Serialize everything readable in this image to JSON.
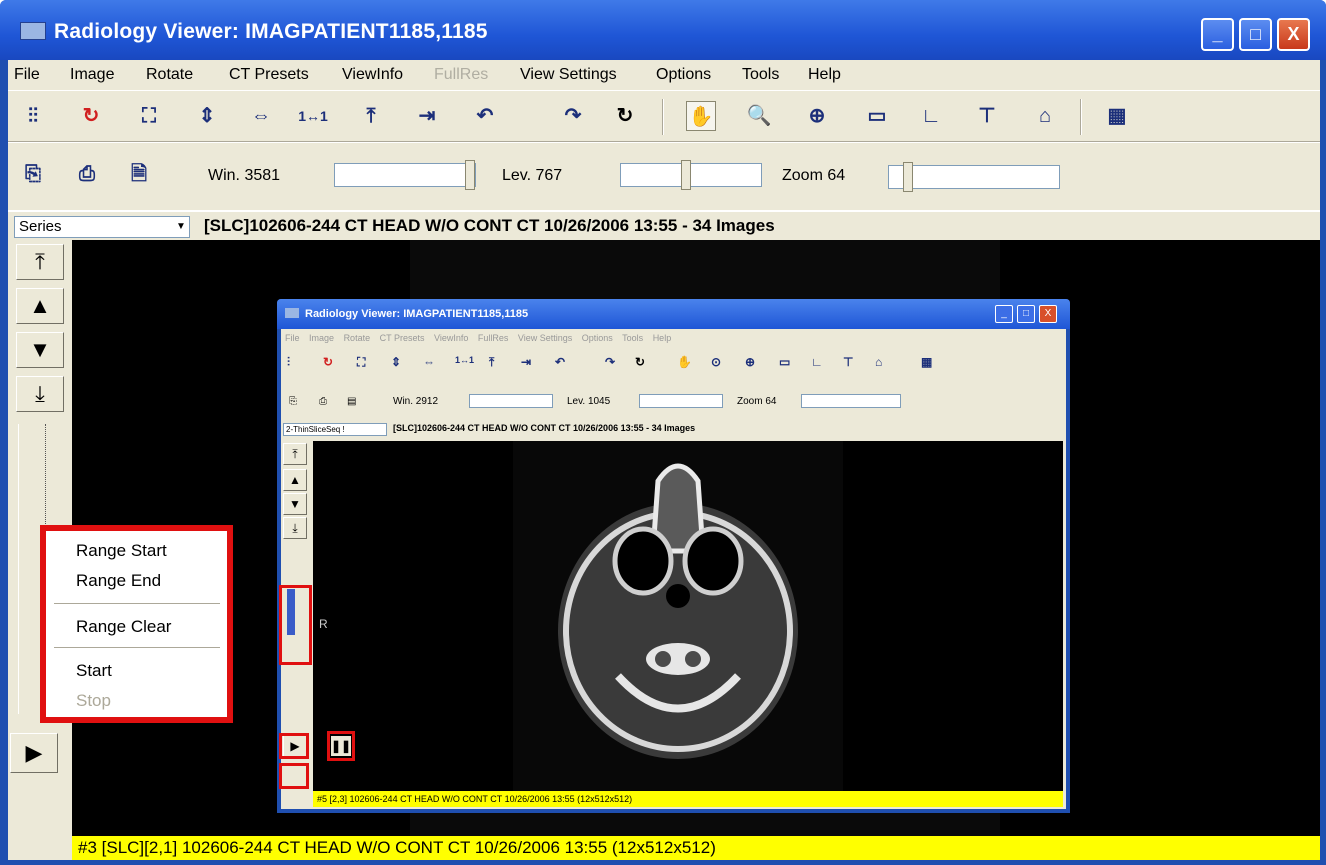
{
  "window": {
    "title": "Radiology Viewer: IMAGPATIENT1185,1185",
    "minimize": "_",
    "maximize": "□",
    "close": "X"
  },
  "menu": [
    "File",
    "Image",
    "Rotate",
    "CT Presets",
    "ViewInfo",
    "FullRes",
    "View Settings",
    "Options",
    "Tools",
    "Help"
  ],
  "menu_disabled": "FullRes",
  "toolbar": {
    "icons": [
      "stack-icon",
      "refresh-icon",
      "fit-icon",
      "flip-vertical-icon",
      "flip-horizontal-icon",
      "one-to-one-icon",
      "fit-height-icon",
      "fit-width-icon",
      "rotate-left-icon",
      "rotate-right-icon",
      "rotate-icon",
      "pan-hand-icon",
      "magnify-icon",
      "zoom-icon",
      "ruler-icon",
      "angle-icon",
      "measure-icon",
      "roi-icon",
      "grid-icon"
    ]
  },
  "toolbar2": {
    "win_label": "Win. 3581",
    "lev_label": "Lev. 767",
    "zoom_label": "Zoom  64"
  },
  "series": {
    "combo": "Series",
    "description": "[SLC]102606-244  CT HEAD W/O CONT CT 10/26/2006 13:55  - 34  Images"
  },
  "status": "#3 [SLC][2,1] 102606-244  CT HEAD W/O CONT CT 10/26/2006 13:55 (12x512x512)",
  "context_menu": {
    "items": [
      "Range Start",
      "Range End",
      "Range Clear",
      "Start",
      "Stop"
    ],
    "disabled": "Stop"
  },
  "inner": {
    "title": "Radiology Viewer: IMAGPATIENT1185,1185",
    "menu": [
      "File",
      "Image",
      "Rotate",
      "CT Presets",
      "ViewInfo",
      "FullRes",
      "View Settings",
      "Options",
      "Tools",
      "Help"
    ],
    "win_label": "Win. 2912",
    "lev_label": "Lev. 1045",
    "zoom_label": "Zoom  64",
    "series_combo": "2-ThinSliceSeq !",
    "series_description": "[SLC]102606-244  CT HEAD W/O CONT CT 10/26/2006 13:55  - 34  Images",
    "status": "#5 [2,3] 102606-244  CT HEAD W/O CONT CT 10/26/2006 13:55 (12x512x512)",
    "orientation_label": "R"
  },
  "colors": {
    "highlight_border": "#e01010",
    "status_bg": "#ffff00",
    "title_blue": "#1f56d6"
  }
}
